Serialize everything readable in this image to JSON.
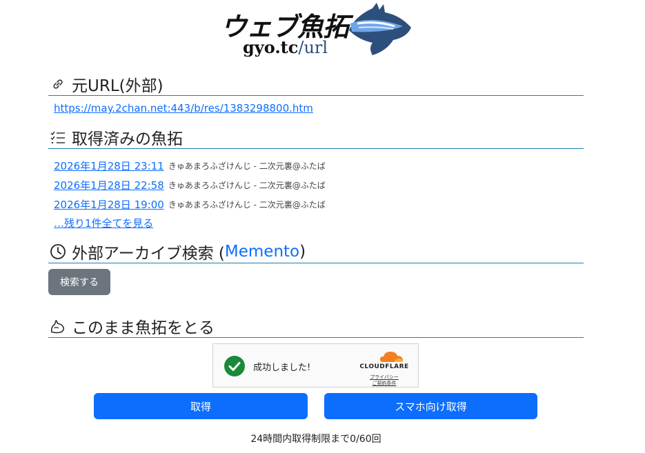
{
  "logo": {
    "title": "ウェブ魚拓",
    "sub_a": "gyo.tc",
    "sub_b": "/url"
  },
  "original_url": {
    "heading": "元URL(外部)",
    "url": "https://may.2chan.net:443/b/res/1383298800.htm"
  },
  "archives": {
    "heading": "取得済みの魚拓",
    "items": [
      {
        "date": "2026年1月28日 23:11",
        "meta": "きゅあまろふざけんじ - 二次元裏@ふたば"
      },
      {
        "date": "2026年1月28日 22:58",
        "meta": "きゅあまろふざけんじ - 二次元裏@ふたば"
      },
      {
        "date": "2026年1月28日 19:00",
        "meta": "きゅあまろふざけんじ - 二次元裏@ふたば"
      }
    ],
    "more_link": "…残り1件全てを見る"
  },
  "external_search": {
    "heading_prefix": "外部アーカイブ検索 (",
    "heading_link": "Memento",
    "heading_suffix": ")",
    "button": "検索する"
  },
  "capture": {
    "heading": "このまま魚拓をとる",
    "captcha_message": "成功しました!",
    "cloudflare_word": "CLOUDFLARE",
    "privacy": "プライバシー",
    "terms": "ご契約条件",
    "button_get": "取得",
    "button_mobile": "スマホ向け取得",
    "limit_text": "24時間内取得制限まで0/60回"
  },
  "colors": {
    "accent": "#0d6efd",
    "rule": "#1e7fa9",
    "secondary_button": "#6c757d",
    "success": "#1a8a3a",
    "cloudflare_orange": "#f38020"
  }
}
